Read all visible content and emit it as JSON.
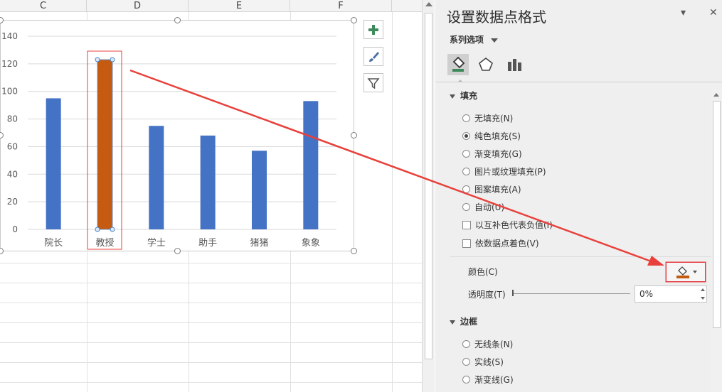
{
  "sheet": {
    "columns": [
      "C",
      "D",
      "E",
      "F"
    ]
  },
  "chart_data": {
    "type": "bar",
    "categories": [
      "院长",
      "教授",
      "学士",
      "助手",
      "猪猪",
      "象象"
    ],
    "series": [
      {
        "values": [
          95,
          123,
          75,
          68,
          57,
          93
        ]
      }
    ],
    "yticks": [
      0,
      20,
      40,
      60,
      80,
      100,
      120,
      140
    ],
    "ylim": [
      0,
      140
    ],
    "grid": true,
    "bar_color": "#4472c4",
    "highlight_color": "#c55a11",
    "highlight_index": 1
  },
  "chart_tools": {
    "add_element_icon": "plus-icon",
    "styles_icon": "brush-icon",
    "filter_icon": "funnel-icon"
  },
  "pane": {
    "title": "设置数据点格式",
    "collapse_glyph": "▾",
    "close_glyph": "✕",
    "series_options_label": "系列选项",
    "fill_section": "填充",
    "fill_options": [
      {
        "label": "无填充(N)",
        "selected": false
      },
      {
        "label": "纯色填充(S)",
        "selected": true
      },
      {
        "label": "渐变填充(G)",
        "selected": false
      },
      {
        "label": "图片或纹理填充(P)",
        "selected": false
      },
      {
        "label": "图案填充(A)",
        "selected": false
      },
      {
        "label": "自动(U)",
        "selected": false
      }
    ],
    "invert_label": "以互补色代表负值(I)",
    "vary_label": "依数据点着色(V)",
    "color_label": "颜色(C)",
    "color_swatch": "#c55a11",
    "transparency_label": "透明度(T)",
    "transparency_value": "0%",
    "border_section": "边框",
    "border_options": [
      {
        "label": "无线条(N)",
        "selected": false
      },
      {
        "label": "实线(S)",
        "selected": false
      },
      {
        "label": "渐变线(G)",
        "selected": false
      }
    ]
  },
  "annotation": {
    "arrow_color": "#e8413c"
  }
}
